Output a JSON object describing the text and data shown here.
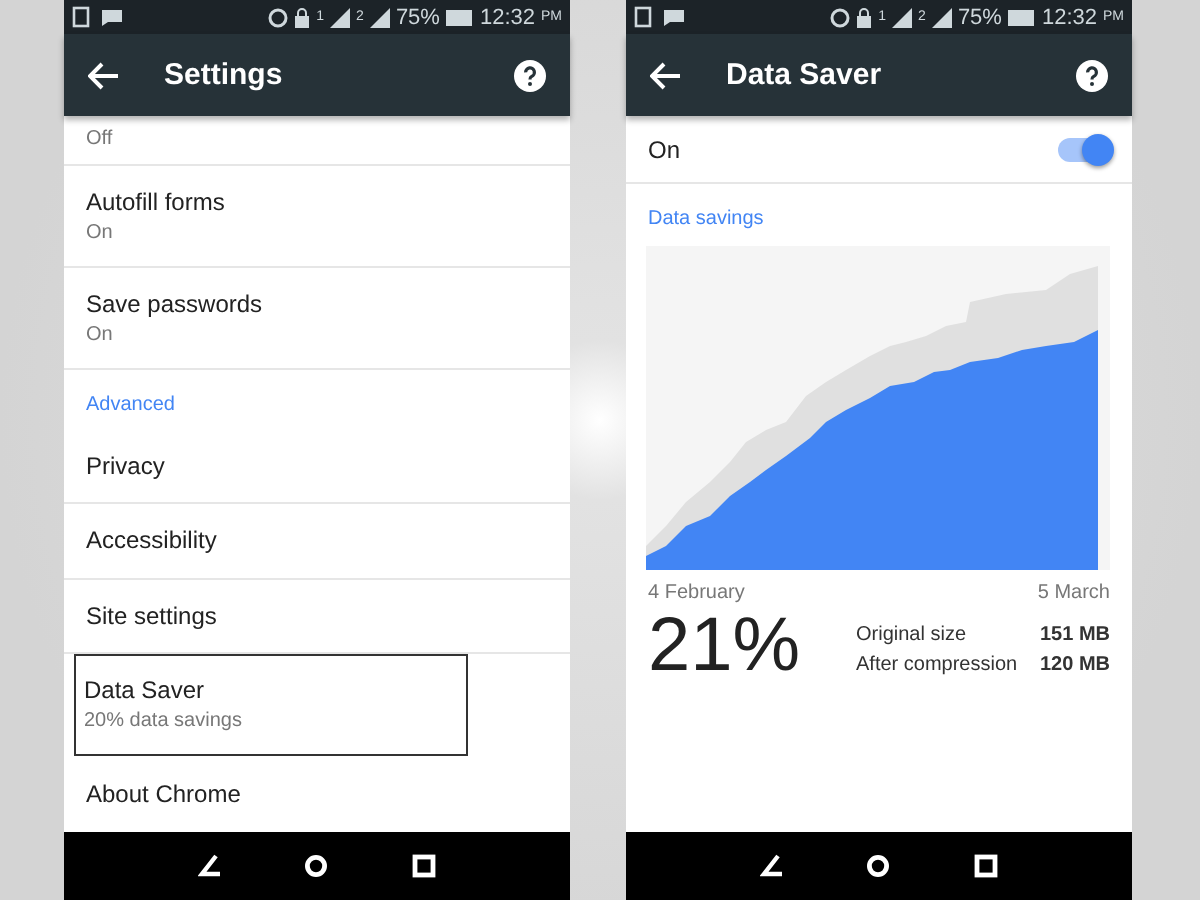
{
  "screens": [
    {
      "kind": "settings",
      "status_bar": {
        "sims": [
          "1",
          "2"
        ],
        "battery": "75%",
        "time": "12:32",
        "ampm": "PM"
      },
      "title": "Settings",
      "items": [
        {
          "kind": "partial",
          "subtitle": "Off"
        },
        {
          "kind": "item",
          "title": "Autofill forms",
          "subtitle": "On",
          "highlighted": false
        },
        {
          "kind": "item",
          "title": "Save passwords",
          "subtitle": "On",
          "highlighted": false
        },
        {
          "kind": "header",
          "title": "Advanced"
        },
        {
          "kind": "item",
          "title": "Privacy",
          "highlighted": false
        },
        {
          "kind": "item",
          "title": "Accessibility",
          "highlighted": false
        },
        {
          "kind": "item",
          "title": "Site settings",
          "highlighted": false
        },
        {
          "kind": "item",
          "title": "Data Saver",
          "subtitle": "20% data savings",
          "highlighted": true
        },
        {
          "kind": "item",
          "title": "About Chrome",
          "highlighted": false
        }
      ]
    },
    {
      "kind": "datasaver",
      "status_bar": {
        "sims": [
          "1",
          "2"
        ],
        "battery": "75%",
        "time": "12:32",
        "ampm": "PM"
      },
      "title": "Data Saver",
      "toggle": {
        "label": "On",
        "on": true
      },
      "section": "Data savings",
      "start_date": "4 February",
      "end_date": "5 March",
      "percent": "21%",
      "stats": [
        {
          "label": "Original size",
          "value": "151 MB"
        },
        {
          "label": "After compression",
          "value": "120 MB"
        }
      ]
    }
  ]
}
